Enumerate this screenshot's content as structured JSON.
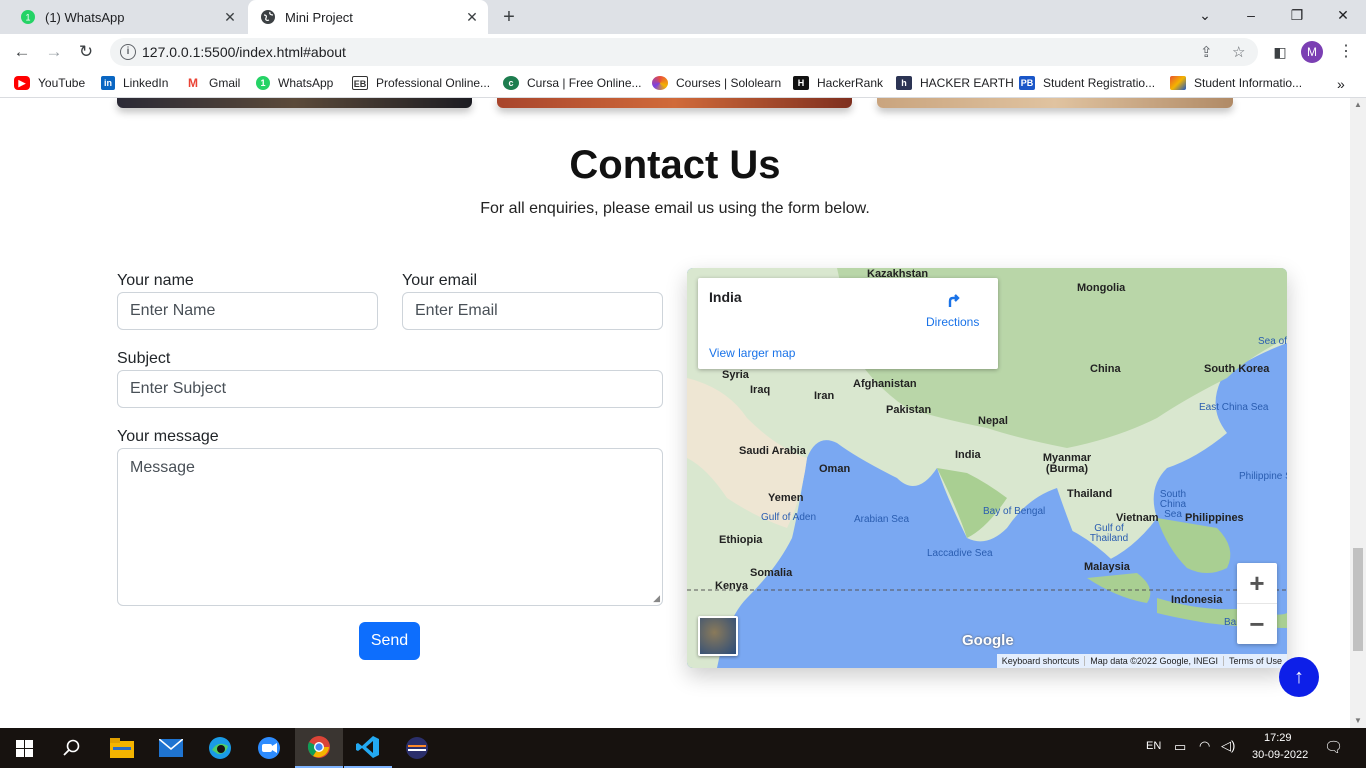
{
  "browser": {
    "tabs": [
      {
        "label": "(1) WhatsApp",
        "icon": "whatsapp-icon"
      },
      {
        "label": "Mini Project",
        "icon": "globe-icon"
      }
    ],
    "url": "127.0.0.1:5500/index.html#about",
    "profile_initial": "M"
  },
  "bookmarks": [
    {
      "label": "YouTube",
      "icon": "youtube-icon",
      "color": "#ff0000"
    },
    {
      "label": "LinkedIn",
      "icon": "linkedin-icon",
      "color": "#0a66c2"
    },
    {
      "label": "Gmail",
      "icon": "gmail-icon",
      "color": "#ea4335"
    },
    {
      "label": "WhatsApp",
      "icon": "whatsapp-icon",
      "color": "#25d366"
    },
    {
      "label": "Professional Online...",
      "icon": "eb-icon",
      "color": "#333333"
    },
    {
      "label": "Cursa | Free Online...",
      "icon": "cursa-icon",
      "color": "#1e7d4f"
    },
    {
      "label": "Courses | Sololearn",
      "icon": "sololearn-icon",
      "color": "#7a3fe4"
    },
    {
      "label": "HackerRank",
      "icon": "hackerrank-icon",
      "color": "#111111"
    },
    {
      "label": "HACKER EARTH",
      "icon": "hackerearth-icon",
      "color": "#2c3454"
    },
    {
      "label": "Student Registratio...",
      "icon": "pb-icon",
      "color": "#1a56c8"
    },
    {
      "label": "Student Informatio...",
      "icon": "student-info-icon",
      "color": "#e8542e"
    }
  ],
  "contact": {
    "title": "Contact Us",
    "subtitle": "For all enquiries, please email us using the form below.",
    "name_label": "Your name",
    "name_placeholder": "Enter Name",
    "email_label": "Your email",
    "email_placeholder": "Enter Email",
    "subject_label": "Subject",
    "subject_placeholder": "Enter Subject",
    "message_label": "Your message",
    "message_placeholder": "Message",
    "send_label": "Send"
  },
  "map": {
    "place": "India",
    "directions": "Directions",
    "larger_map": "View larger map",
    "labels": [
      "Kazakhstan",
      "Mongolia",
      "Syria",
      "Iraq",
      "Afghanistan",
      "Iran",
      "Pakistan",
      "China",
      "South Korea",
      "Nepal",
      "Saudi Arabia",
      "India",
      "Myanmar (Burma)",
      "Oman",
      "Yemen",
      "Thailand",
      "Vietnam",
      "Philippines",
      "Ethiopia",
      "Somalia",
      "Kenya",
      "Malaysia",
      "Indonesia"
    ],
    "water_labels": [
      "Sea of J",
      "East China Sea",
      "Gulf of Aden",
      "Arabian Sea",
      "Bay of Bengal",
      "Laccadive Sea",
      "South China Sea",
      "Gulf of Thailand",
      "Philippine S",
      "Banda"
    ],
    "attribution": [
      "Keyboard shortcuts",
      "Map data ©2022 Google, INEGI",
      "Terms of Use"
    ],
    "logo": "Google"
  },
  "taskbar": {
    "language": "EN",
    "time": "17:29",
    "date": "30-09-2022"
  }
}
